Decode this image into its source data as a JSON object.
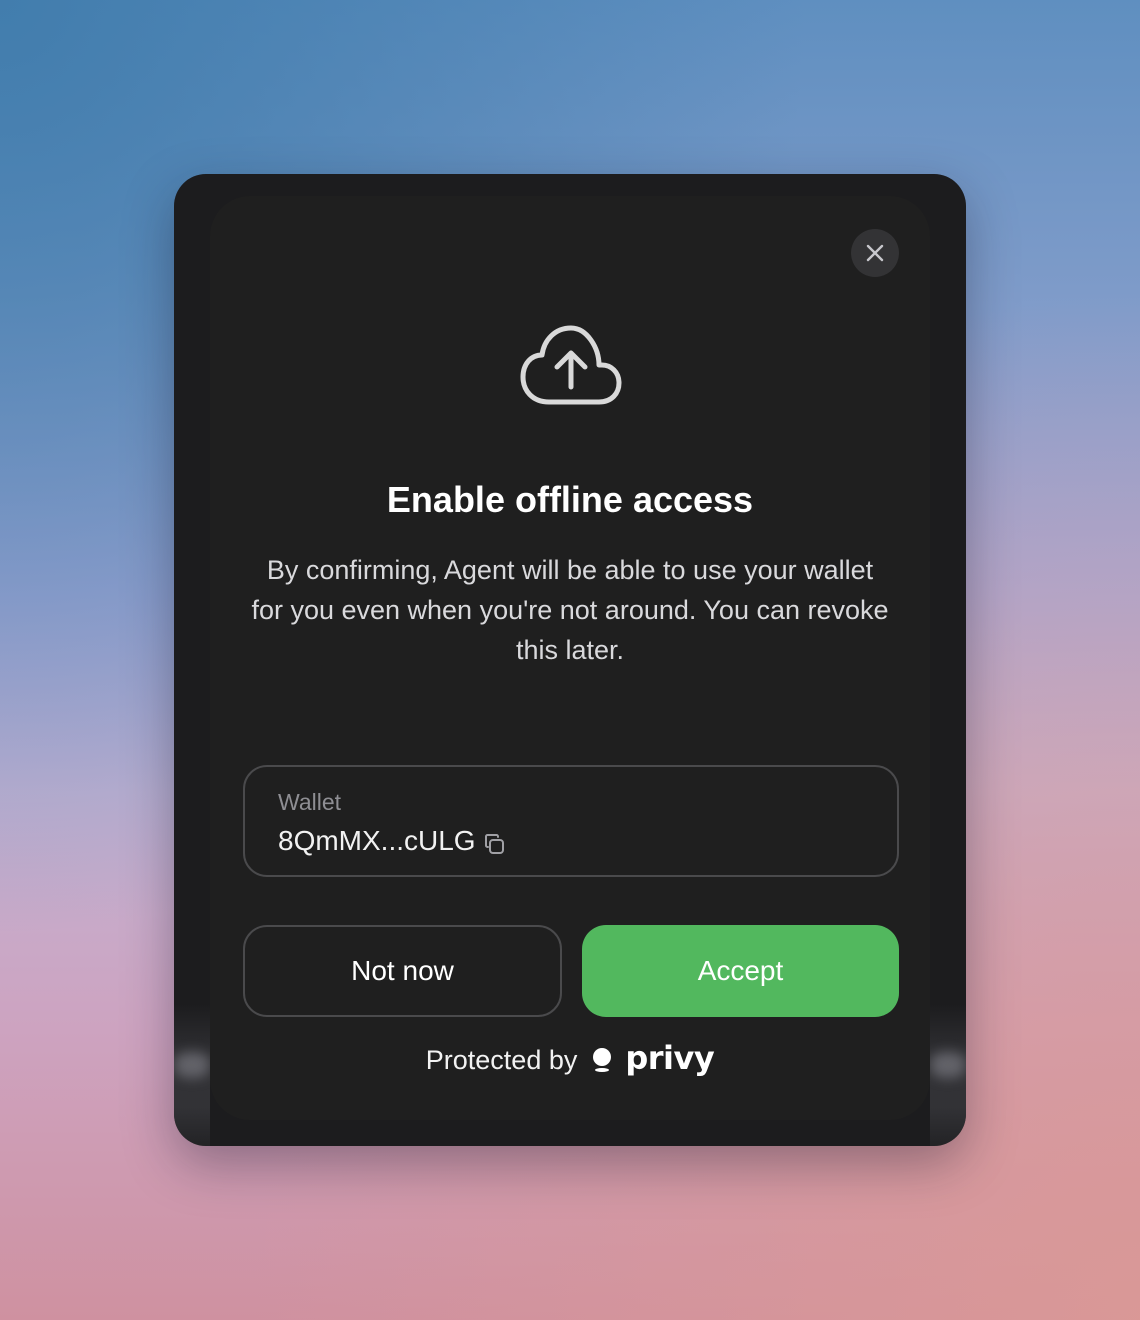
{
  "modal": {
    "title": "Enable offline access",
    "description": "By confirming, Agent will be able to use your wallet for you even when you're not around. You can revoke this later.",
    "header_icon": "cloud-upload-icon",
    "close_icon": "close-icon"
  },
  "wallet": {
    "label": "Wallet",
    "address": "8QmMX...cULG",
    "copy_icon": "copy-icon"
  },
  "actions": {
    "secondary_label": "Not now",
    "primary_label": "Accept"
  },
  "footer": {
    "text": "Protected by",
    "brand": "privy",
    "brand_icon": "privy-logo-icon"
  },
  "colors": {
    "modal_bg": "#1f1f1f",
    "accent_green": "#52b85e",
    "border": "#4a4a4c",
    "muted_text": "#8e8e93"
  }
}
